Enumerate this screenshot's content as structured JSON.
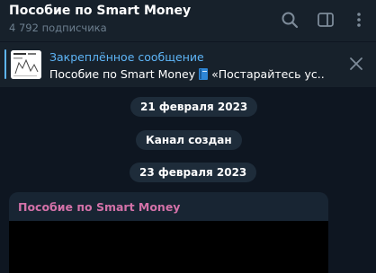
{
  "header": {
    "title": "Пособие по Smart Money",
    "subtitle": "4 792 подписчика",
    "icons": [
      "search-icon",
      "sidebar-toggle-icon",
      "more-vertical-icon"
    ]
  },
  "pinned": {
    "label": "Закреплённое сообщение",
    "text_prefix": "Пособие по Smart Money",
    "text_suffix": "«Постарайтесь ус...",
    "close_icon": "close-icon"
  },
  "service": {
    "date1": "21 февраля 2023",
    "channel_created": "Канал создан",
    "date2": "23 февраля 2023"
  },
  "message": {
    "author": "Пособие по Smart Money"
  },
  "colors": {
    "background": "#0e1621",
    "panel": "#17212b",
    "accent": "#5eb5f7",
    "author": "#d371a8",
    "muted": "#6d7f8f",
    "bubble": "#182533"
  }
}
